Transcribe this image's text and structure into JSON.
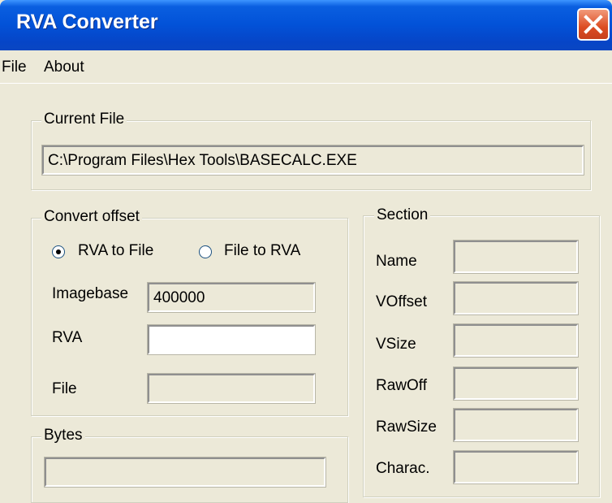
{
  "window": {
    "title": "RVA Converter",
    "close_icon": "close-icon"
  },
  "menu": {
    "items": [
      "File",
      "About"
    ]
  },
  "current_file": {
    "legend": "Current File",
    "path": "C:\\Program Files\\Hex Tools\\BASECALC.EXE"
  },
  "convert": {
    "legend": "Convert offset",
    "radio_rva_to_file": "RVA to File",
    "radio_file_to_rva": "File to RVA",
    "selected": "RVA to File",
    "imagebase_label": "Imagebase",
    "imagebase_value": "400000",
    "rva_label": "RVA",
    "rva_value": "",
    "file_label": "File",
    "file_value": ""
  },
  "section": {
    "legend": "Section",
    "labels": [
      "Name",
      "VOffset",
      "VSize",
      "RawOff",
      "RawSize",
      "Charac."
    ]
  },
  "bytes": {
    "legend": "Bytes",
    "value": ""
  },
  "colors": {
    "titlebar": "#0645c7",
    "face": "#ece9d8",
    "close": "#dc4c22"
  }
}
